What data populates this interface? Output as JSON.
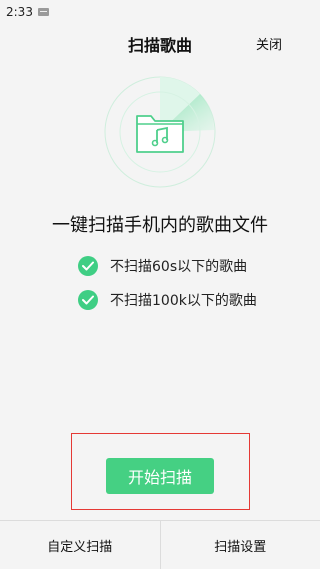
{
  "status_bar": {
    "time": "2:33"
  },
  "header": {
    "title": "扫描歌曲",
    "close_label": "关闭"
  },
  "main": {
    "headline": "一键扫描手机内的歌曲文件",
    "features": [
      {
        "label": "不扫描60s以下的歌曲"
      },
      {
        "label": "不扫描100k以下的歌曲"
      }
    ],
    "start_button_label": "开始扫描"
  },
  "bottom_bar": {
    "custom_scan_label": "自定义扫描",
    "scan_settings_label": "扫描设置"
  },
  "colors": {
    "accent": "#45d083",
    "check": "#3fce84",
    "highlight_border": "#e53935",
    "background": "#f4f4f4"
  }
}
